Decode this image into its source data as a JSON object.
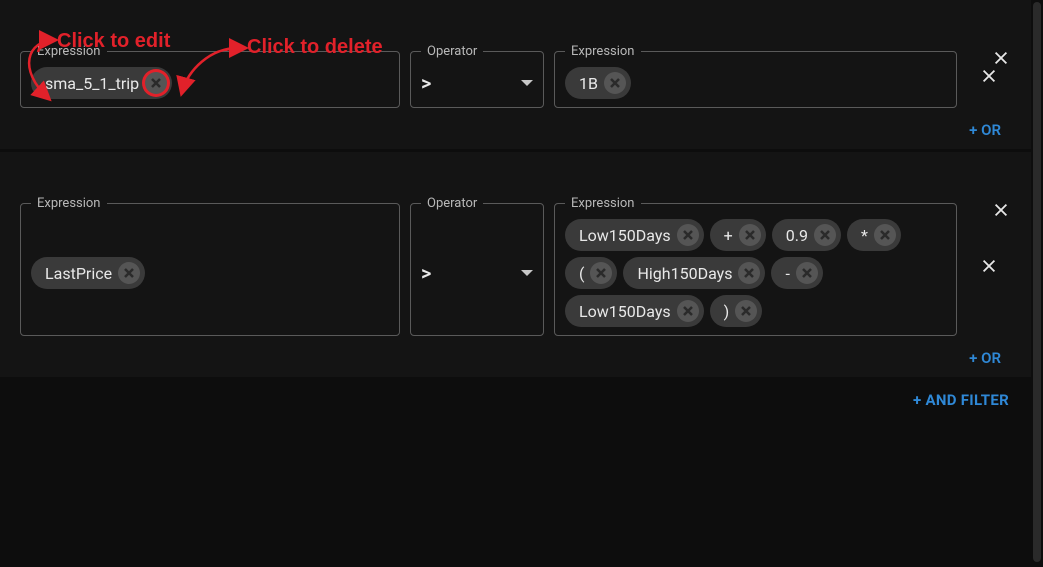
{
  "annotations": {
    "edit_label": "Click to edit",
    "delete_label": "Click to delete"
  },
  "actions": {
    "or": "+ OR",
    "and_filter": "+ AND FILTER"
  },
  "labels": {
    "expression": "Expression",
    "operator": "Operator"
  },
  "groups": [
    {
      "rows": [
        {
          "left": [
            {
              "text": "sma_5_1_trip",
              "highlight": true
            }
          ],
          "operator": ">",
          "right": [
            {
              "text": "1B"
            }
          ]
        }
      ]
    },
    {
      "rows": [
        {
          "left": [
            {
              "text": "LastPrice"
            }
          ],
          "operator": ">",
          "right": [
            {
              "text": "Low150Days"
            },
            {
              "text": "+"
            },
            {
              "text": "0.9"
            },
            {
              "text": "*"
            },
            {
              "text": "("
            },
            {
              "text": "High150Days"
            },
            {
              "text": "-"
            },
            {
              "text": "Low150Days"
            },
            {
              "text": ")"
            }
          ]
        }
      ]
    }
  ]
}
